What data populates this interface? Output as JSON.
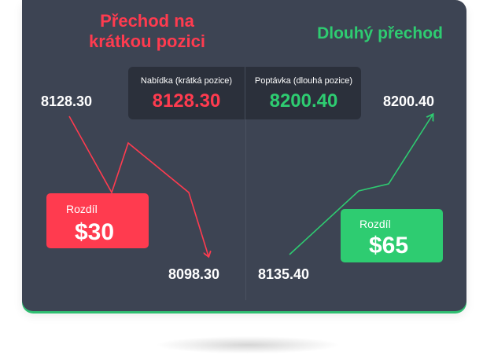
{
  "short": {
    "heading": "Přechod na krátkou pozici",
    "start_price": "8128.30",
    "end_price": "8098.30",
    "diff_label": "Rozdíl",
    "diff_value": "$30",
    "color": "#ff3b4f"
  },
  "long": {
    "heading": "Dlouhý přechod",
    "start_price": "8135.40",
    "end_price": "8200.40",
    "diff_label": "Rozdíl",
    "diff_value": "$65",
    "color": "#2ecc71"
  },
  "quotes": {
    "bid_label": "Nabídka (krátká pozice)",
    "bid_value": "8128.30",
    "ask_label": "Poptávka (dlouhá pozice)",
    "ask_value": "8200.40"
  },
  "colors": {
    "panel": "#3d4453",
    "quote_box": "#2b303b",
    "accent_green": "#2fbf71"
  }
}
